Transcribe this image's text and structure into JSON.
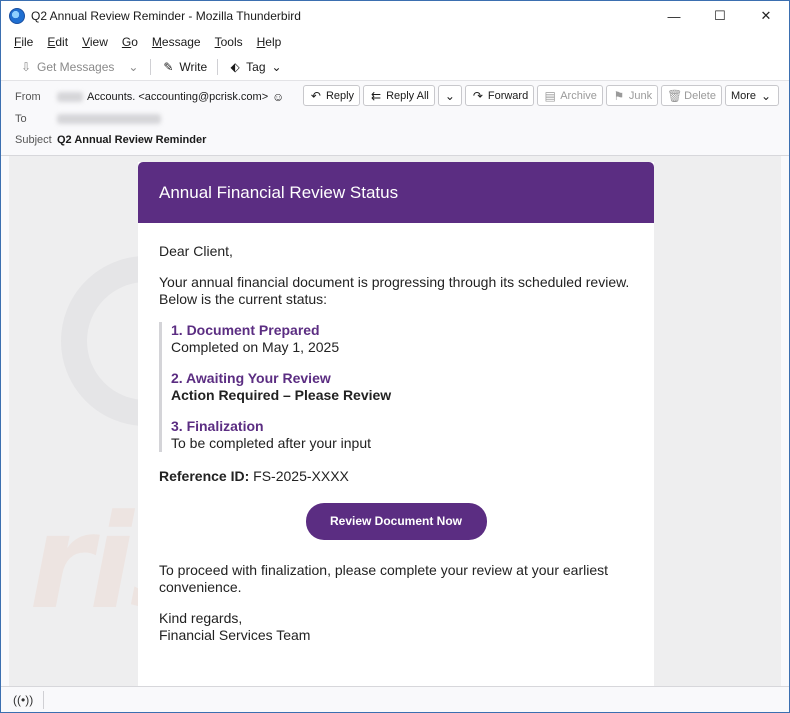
{
  "window": {
    "title": "Q2 Annual Review Reminder - Mozilla Thunderbird",
    "minimize": "—",
    "maximize": "☐",
    "close": "✕"
  },
  "menu": [
    {
      "label": "File",
      "key": "F"
    },
    {
      "label": "Edit",
      "key": "E"
    },
    {
      "label": "View",
      "key": "V"
    },
    {
      "label": "Go",
      "key": "G"
    },
    {
      "label": "Message",
      "key": "M"
    },
    {
      "label": "Tools",
      "key": "T"
    },
    {
      "label": "Help",
      "key": "H"
    }
  ],
  "toolbar": {
    "get_messages": "Get Messages",
    "write": "Write",
    "tag": "Tag"
  },
  "header": {
    "from_label": "From",
    "from_display": "Accounts. <accounting@pcrisk.com>",
    "to_label": "To",
    "subject_label": "Subject",
    "subject_value": "Q2 Annual Review Reminder",
    "actions": {
      "reply": "Reply",
      "reply_all": "Reply All",
      "forward": "Forward",
      "archive": "Archive",
      "junk": "Junk",
      "delete": "Delete",
      "more": "More"
    }
  },
  "email": {
    "banner_title": "Annual Financial Review Status",
    "greeting": "Dear Client,",
    "intro": "Your annual financial document is progressing through its scheduled review. Below is the current status:",
    "steps": [
      {
        "title": "1. Document Prepared",
        "desc": "Completed on May 1, 2025"
      },
      {
        "title": "2. Awaiting Your Review",
        "desc": "Action Required – Please Review"
      },
      {
        "title": "3. Finalization",
        "desc": "To be completed after your input"
      }
    ],
    "reference_label": "Reference ID:",
    "reference_value": "FS-2025-XXXX",
    "cta_label": "Review Document Now",
    "closing": "To proceed with finalization, please complete your review at your earliest convenience.",
    "signoff": "Kind regards,",
    "signature": "Financial Services Team"
  },
  "watermark": {
    "primary": "PC",
    "secondary": "risk.com"
  }
}
